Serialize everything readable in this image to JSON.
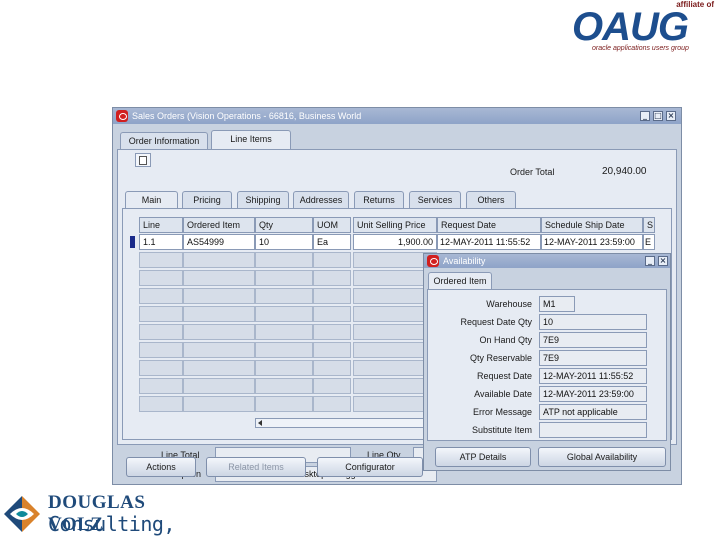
{
  "oaug": {
    "affiliate": "affiliate of",
    "word": "OAUG",
    "tagline": "oracle applications users group"
  },
  "douglas": {
    "name": "DOUGLAS VOLZ",
    "sub": "Consulting, Inc."
  },
  "window": {
    "title": "Sales Orders (Vision Operations - 66816, Business World",
    "tabs": [
      "Order Information",
      "Line Items"
    ],
    "order_total_label": "Order Total",
    "order_total_value": "20,940.00",
    "subtabs": [
      "Main",
      "Pricing",
      "Shipping",
      "Addresses",
      "Returns",
      "Services",
      "Others"
    ],
    "columns": [
      "Line",
      "Ordered Item",
      "Qty",
      "UOM",
      "Unit Selling Price",
      "Request Date",
      "Schedule Ship Date",
      "S"
    ],
    "row": {
      "line": "1.1",
      "item": "AS54999",
      "qty": "10",
      "uom": "Ea",
      "price": "1,900.00",
      "request_date": "12-MAY-2011 11:55:52",
      "schedule_date": "12-MAY-2011 23:59:00",
      "s": "E"
    },
    "line_total_label": "Line Total",
    "line_qty_label": "Line Qty",
    "description_label": "Description",
    "description_value": "Sentinel Standard Desktop - Rugged",
    "buttons": [
      "Actions",
      "Related Items",
      "Configurator"
    ]
  },
  "availability": {
    "title": "Availability",
    "tab": "Ordered Item",
    "fields": [
      {
        "label": "Warehouse",
        "value": "M1"
      },
      {
        "label": "Request Date Qty",
        "value": "10"
      },
      {
        "label": "On Hand Qty",
        "value": "7E9"
      },
      {
        "label": "Qty Reservable",
        "value": "7E9"
      },
      {
        "label": "Request Date",
        "value": "12-MAY-2011 11:55:52"
      },
      {
        "label": "Available Date",
        "value": "12-MAY-2011 23:59:00"
      },
      {
        "label": "Error Message",
        "value": "ATP not applicable"
      },
      {
        "label": "Substitute Item",
        "value": ""
      }
    ],
    "buttons": [
      "ATP Details",
      "Global Availability"
    ]
  }
}
